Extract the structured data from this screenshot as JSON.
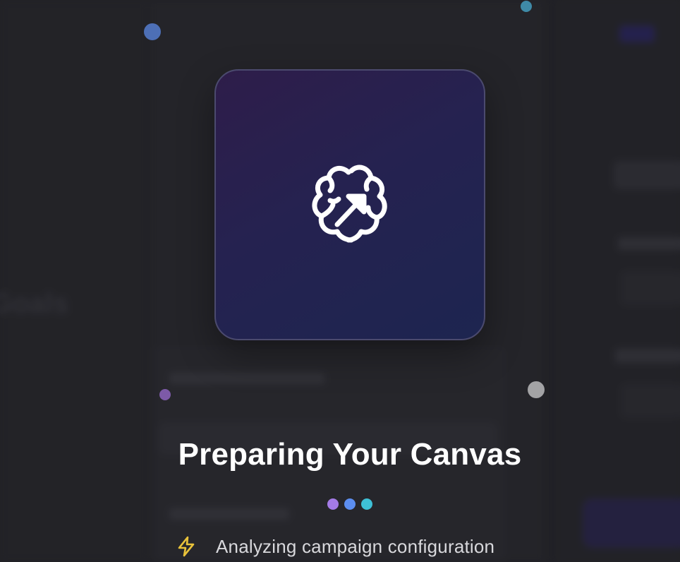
{
  "background": {
    "heading_fragment": "Goals"
  },
  "loader": {
    "logo_icon": "brain-arrow-icon",
    "title": "Preparing Your Canvas",
    "progress_dots": [
      "#a47be6",
      "#5c8ef0",
      "#3ec0d6"
    ],
    "status_icon": "lightning-bolt-icon",
    "status_text": "Analyzing campaign configuration"
  },
  "colors": {
    "accent_purple": "#a47be6",
    "accent_blue": "#5c8ef0",
    "accent_cyan": "#3ec0d6",
    "status_icon": "#e8c23a",
    "card_border": "#4b4a6e"
  }
}
